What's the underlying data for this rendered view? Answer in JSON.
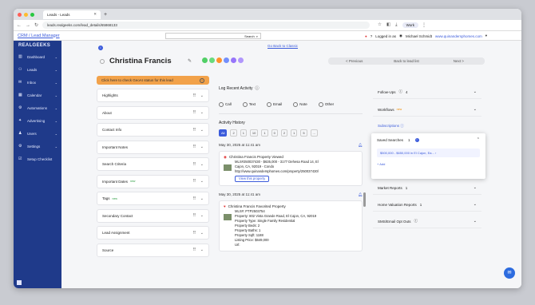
{
  "browser": {
    "tab_title": "Leads - Leads",
    "url": "leads.realgeeks.com/lead_details/65868133",
    "work_label": "Work"
  },
  "crm": {
    "title_link": "CRM / Lead Manager",
    "search_label": "Search",
    "logged_in": "Logged in as",
    "user_name": "Michael Schmidt",
    "site_link": "www.quinandersphomes.com"
  },
  "sidebar": {
    "brand": "REALGEEKS",
    "items": [
      {
        "label": "Dashboard",
        "icon": "dashboard-icon",
        "glyph": "▥"
      },
      {
        "label": "Leads",
        "icon": "leads-icon",
        "glyph": "⚇"
      },
      {
        "label": "Inbox",
        "icon": "inbox-icon",
        "glyph": "✉"
      },
      {
        "label": "Calendar",
        "icon": "calendar-icon",
        "glyph": "▦"
      },
      {
        "label": "Automations",
        "icon": "automations-icon",
        "glyph": "⚙"
      },
      {
        "label": "Advertising",
        "icon": "advertising-icon",
        "glyph": "✦"
      },
      {
        "label": "Users",
        "icon": "users-icon",
        "glyph": "♟"
      },
      {
        "label": "Settings",
        "icon": "settings-icon",
        "glyph": "⚙"
      },
      {
        "label": "Setup Checklist",
        "icon": "checklist-icon",
        "glyph": "☑"
      }
    ]
  },
  "lead": {
    "go_back": "Go Back to Classic",
    "name": "Christina Francis",
    "pager": {
      "prev": "< Previous",
      "back": "Back to lead list",
      "next": "Next >"
    }
  },
  "left_panel": {
    "geo_banner": "Click here to check GeoAI status for this lead",
    "sections": [
      "Highlights",
      "About",
      "Contact Info",
      "Important Notes",
      "Search Criteria",
      "Important Dates",
      "Tags",
      "Secondary Contact",
      "Lead Assignment",
      "Source"
    ],
    "new_badge": "new"
  },
  "activity": {
    "log_title": "Log Recent Activity",
    "radios": [
      "Call",
      "Text",
      "Email",
      "Note",
      "Other"
    ],
    "history_title": "Activity History",
    "filters": [
      "All",
      "2",
      "1",
      "10",
      "1",
      "0",
      "2",
      "1",
      "5",
      "..."
    ],
    "entries": [
      {
        "date": "May 30, 2025 at 11:41 am",
        "title": "Christina Francis Property Viewed",
        "lines": [
          "MLS#250037430 - $635,000 - 3177 Dehesa Road 14, El",
          "Cajon, CA, 92019 - Condo",
          "http://www.quinandersphomes.com/property/250037430/"
        ],
        "button": "View this property"
      },
      {
        "date": "May 30, 2025 at 11:41 am",
        "title": "Christina Francis Favorited Property",
        "lines": [
          "MLS#: PTP2503754",
          "Property: 802 Vista Grande Road, El Cajon, CA, 92019",
          "Property Type: Single Family Residential",
          "Property Beds: 2",
          "Property Baths: 1",
          "Property Sqft: 1188",
          "Listing Price: $649,000",
          "Url:"
        ]
      }
    ]
  },
  "right_panel": {
    "follow_ups": "Follow-Ups",
    "follow_ups_count": "4",
    "workflows": "Workflows",
    "workflows_badge": "new",
    "subscriptions": "Subscriptions",
    "saved_searches": "Saved Searches",
    "saved_count": "1",
    "saved_item": "$500,000 - $650,000 in El Cajon, Ea...",
    "add": "+ Add",
    "market_reports": "Market Reports",
    "market_count": "1",
    "home_valuation": "Home Valuation Reports",
    "home_count": "1",
    "sms_opt_outs": "SMS/Email Opt Outs"
  }
}
